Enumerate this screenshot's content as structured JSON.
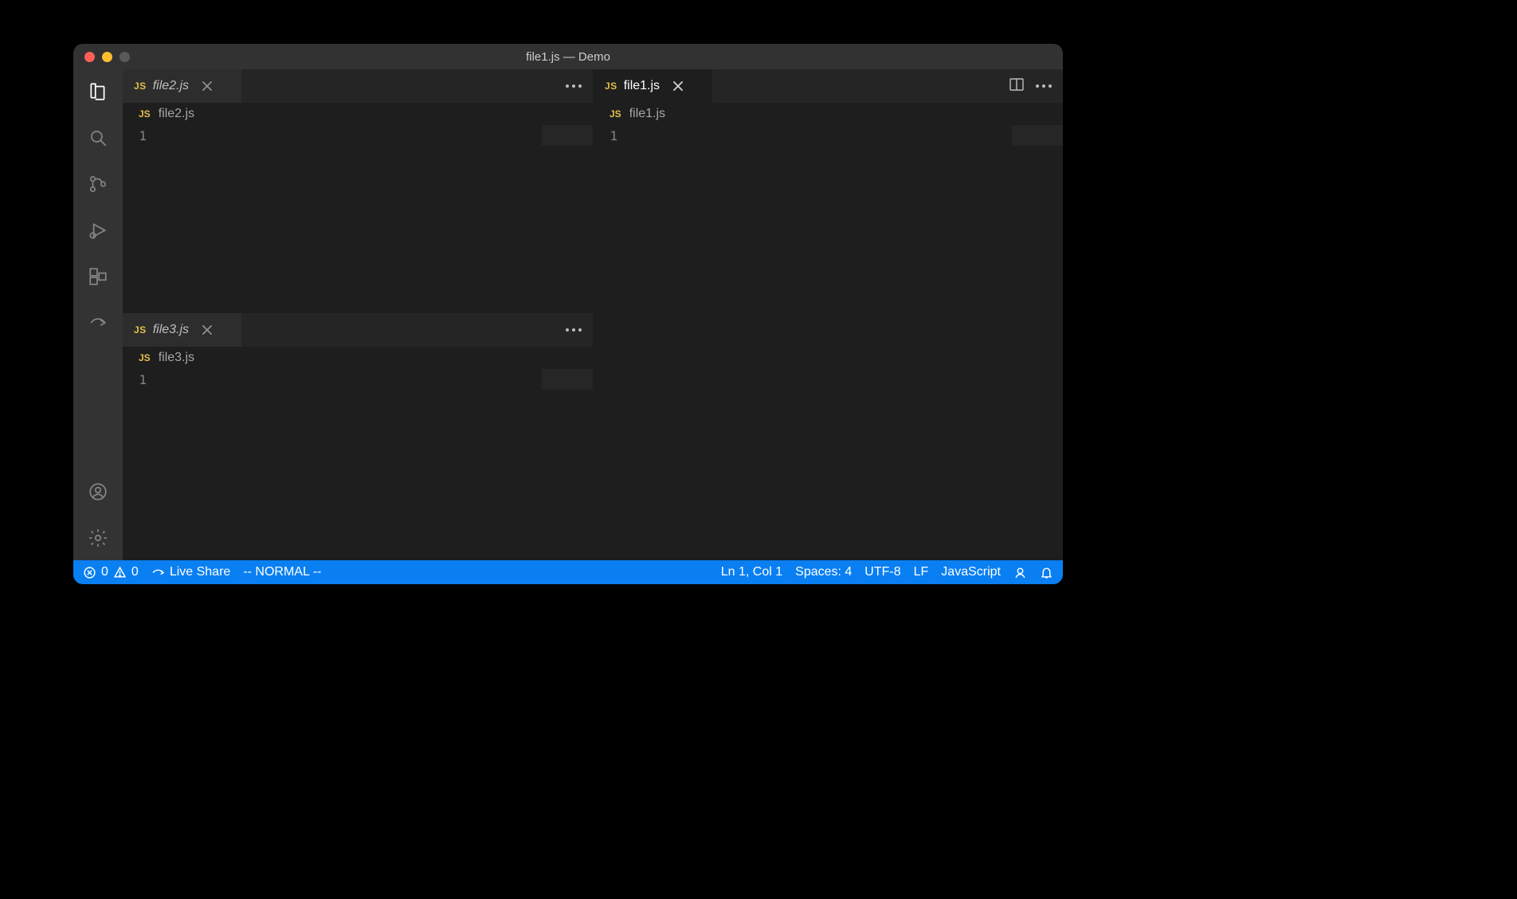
{
  "window": {
    "title": "file1.js — Demo"
  },
  "activitybar": {
    "items": [
      {
        "name": "explorer",
        "active": true
      },
      {
        "name": "search"
      },
      {
        "name": "source-control"
      },
      {
        "name": "run-debug"
      },
      {
        "name": "extensions"
      },
      {
        "name": "live-share"
      }
    ],
    "bottom": [
      {
        "name": "account"
      },
      {
        "name": "settings"
      }
    ]
  },
  "editors": {
    "left_top": {
      "tab": {
        "file": "file2.js",
        "italic": true,
        "lang_badge": "JS"
      },
      "breadcrumb": "file2.js",
      "line_numbers": [
        "1"
      ]
    },
    "left_bottom": {
      "tab": {
        "file": "file3.js",
        "italic": true,
        "lang_badge": "JS"
      },
      "breadcrumb": "file3.js",
      "line_numbers": [
        "1"
      ]
    },
    "right": {
      "tab": {
        "file": "file1.js",
        "italic": false,
        "lang_badge": "JS"
      },
      "breadcrumb": "file1.js",
      "line_numbers": [
        "1"
      ]
    }
  },
  "statusbar": {
    "errors": "0",
    "warnings": "0",
    "live_share": "Live Share",
    "vim_mode": "-- NORMAL --",
    "position": "Ln 1, Col 1",
    "indent": "Spaces: 4",
    "encoding": "UTF-8",
    "eol": "LF",
    "language": "JavaScript"
  }
}
